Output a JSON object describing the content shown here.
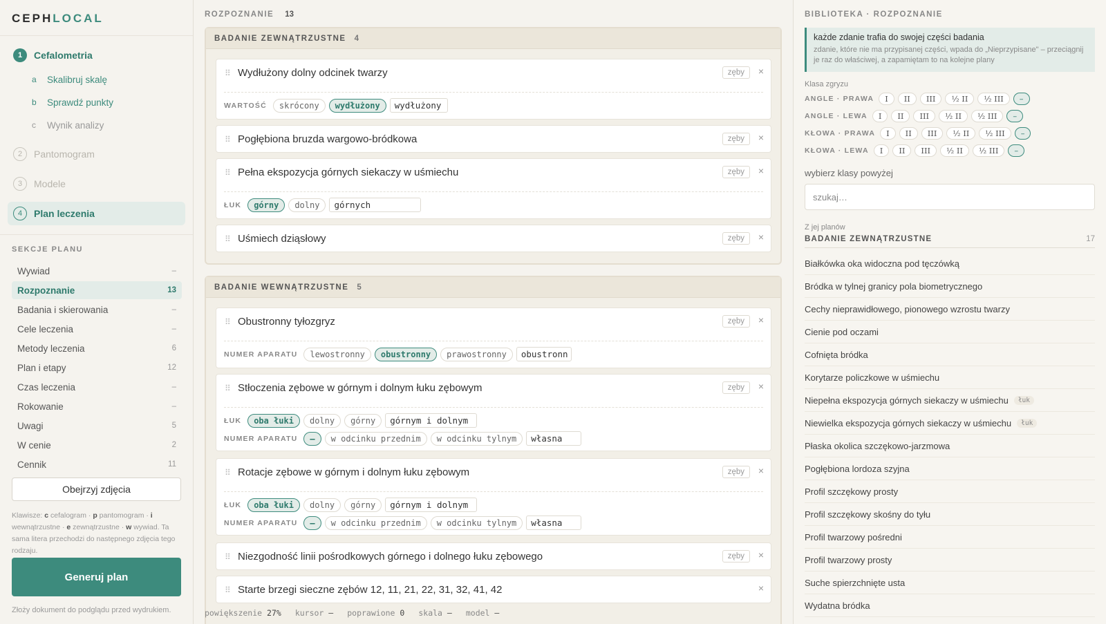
{
  "app": {
    "logo_a": "CEPH",
    "logo_b": "LOCAL"
  },
  "steps": [
    {
      "num": "1",
      "label": "Cefalometria"
    },
    {
      "num": "2",
      "label": "Pantomogram"
    },
    {
      "num": "3",
      "label": "Modele"
    },
    {
      "num": "4",
      "label": "Plan leczenia"
    }
  ],
  "substeps": [
    {
      "letter": "a",
      "label": "Skalibruj skalę"
    },
    {
      "letter": "b",
      "label": "Sprawdź punkty"
    },
    {
      "letter": "c",
      "label": "Wynik analizy"
    }
  ],
  "plan_sections": {
    "title": "SEKCJE PLANU",
    "items": [
      {
        "label": "Wywiad",
        "count": "–"
      },
      {
        "label": "Rozpoznanie",
        "count": "13"
      },
      {
        "label": "Badania i skierowania",
        "count": "–"
      },
      {
        "label": "Cele leczenia",
        "count": "–"
      },
      {
        "label": "Metody leczenia",
        "count": "6"
      },
      {
        "label": "Plan i etapy",
        "count": "12"
      },
      {
        "label": "Czas leczenia",
        "count": "–"
      },
      {
        "label": "Rokowanie",
        "count": "–"
      },
      {
        "label": "Uwagi",
        "count": "5"
      },
      {
        "label": "W cenie",
        "count": "2"
      },
      {
        "label": "Cennik",
        "count": "11"
      }
    ]
  },
  "sidebar": {
    "photos_button": "Obejrzyj zdjęcia",
    "shortcuts": {
      "prefix": "Klawisze: ",
      "k1": "c",
      "t1": " cefalogram · ",
      "k2": "p",
      "t2": " pantomogram · ",
      "k3": "i",
      "t3": " wewnątrzustne · ",
      "k4": "e",
      "t4": " zewnątrzustne · ",
      "k5": "w",
      "t5": " wywiad. Ta sama litera przechodzi do następnego zdjęcia tego rodzaju."
    },
    "generate_button": "Generuj plan",
    "generate_hint": "Złoży dokument do podglądu przed wydrukiem."
  },
  "main": {
    "title": "ROZPOZNANIE",
    "count": "13",
    "groups": [
      {
        "title": "BADANIE ZEWNĄTRZUSTNE",
        "count": "4"
      },
      {
        "title": "BADANIE WEWNĄTRZUSTNE",
        "count": "5"
      }
    ],
    "tag_label": "zęby",
    "cards": [
      {
        "title": "Wydłużony dolny odcinek twarzy",
        "row_label": "WARTOŚĆ",
        "chips": [
          "skrócony",
          "wydłużony"
        ],
        "field": "wydłużony"
      },
      {
        "title": "Pogłębiona bruzda wargowo-bródkowa"
      },
      {
        "title": "Pełna ekspozycja górnych siekaczy w uśmiechu",
        "row_label": "ŁUK",
        "chips": [
          "górny",
          "dolny"
        ],
        "field": "górnych"
      },
      {
        "title": "Uśmiech dziąsłowy"
      },
      {
        "title": "Obustronny tyłozgryz",
        "row_label": "NUMER APARATU",
        "chips": [
          "lewostronny",
          "obustronny",
          "prawostronny"
        ],
        "field": "obustronn"
      },
      {
        "title": "Stłoczenia zębowe  w górnym i dolnym łuku zębowym",
        "row_label": "ŁUK",
        "chips": [
          "oba łuki",
          "dolny",
          "górny"
        ],
        "field": "górnym i dolnym",
        "row2_label": "NUMER APARATU",
        "chips2": [
          "–",
          "w odcinku przednim",
          "w odcinku tylnym"
        ],
        "field2": "własna"
      },
      {
        "title": "Rotacje zębowe  w górnym i dolnym łuku zębowym",
        "row_label": "ŁUK",
        "chips": [
          "oba łuki",
          "dolny",
          "górny"
        ],
        "field": "górnym i dolnym",
        "row2_label": "NUMER APARATU",
        "chips2": [
          "–",
          "w odcinku przednim",
          "w odcinku tylnym"
        ],
        "field2": "własna"
      },
      {
        "title": "Niezgodność linii pośrodkowych górnego i dolnego łuku zębowego"
      },
      {
        "title": "Starte brzegi sieczne zębów 12, 11, 21, 22, 31, 32, 41, 42"
      }
    ],
    "status": {
      "zoom_label": "powiększenie",
      "zoom": "27%",
      "cursor_label": "kursor",
      "cursor": "–",
      "fixed_label": "poprawione",
      "fixed": "0",
      "scale_label": "skala",
      "scale": "–",
      "model_label": "model",
      "model": "–"
    }
  },
  "library": {
    "title": "BIBLIOTEKA · ROZPOZNANIE",
    "note_title": "każde zdanie trafia do swojej części badania",
    "note_body": "zdanie, które nie ma przypisanej części, wpada do „Nieprzypisane\" – przeciągnij je raz do właściwej, a zapamiętam to na kolejne plany",
    "klasa_label": "Klasa zgryzu",
    "klasa_rows": [
      {
        "label": "ANGLE · PRAWA",
        "opts": [
          "I",
          "II",
          "III",
          "½ II",
          "½ III",
          "–"
        ]
      },
      {
        "label": "ANGLE · LEWA",
        "opts": [
          "I",
          "II",
          "III",
          "½ II",
          "½ III",
          "–"
        ]
      },
      {
        "label": "KŁOWA · PRAWA",
        "opts": [
          "I",
          "II",
          "III",
          "½ II",
          "½ III",
          "–"
        ]
      },
      {
        "label": "KŁOWA · LEWA",
        "opts": [
          "I",
          "II",
          "III",
          "½ II",
          "½ III",
          "–"
        ]
      }
    ],
    "hint": "wybierz klasy powyżej",
    "search_placeholder": "szukaj…",
    "from_label": "Z jej planów",
    "group_title": "BADANIE ZEWNĄTRZUSTNE",
    "group_count": "17",
    "mini_tag": "łuk",
    "items": [
      "Białkówka oka widoczna pod tęczówką",
      "Bródka w tylnej granicy pola biometrycznego",
      "Cechy nieprawidłowego, pionowego wzrostu twarzy",
      "Cienie pod oczami",
      "Cofnięta bródka",
      "Korytarze policzkowe w uśmiechu",
      "Niepełna ekspozycja górnych siekaczy w uśmiechu",
      "Niewielka ekspozycja górnych siekaczy w uśmiechu",
      "Płaska okolica szczękowo-jarzmowa",
      "Pogłębiona lordoza szyjna",
      "Profil szczękowy prosty",
      "Profil szczękowy skośny do tyłu",
      "Profil twarzowy pośredni",
      "Profil twarzowy prosty",
      "Suche spierzchnięte usta",
      "Wydatna bródka"
    ]
  }
}
